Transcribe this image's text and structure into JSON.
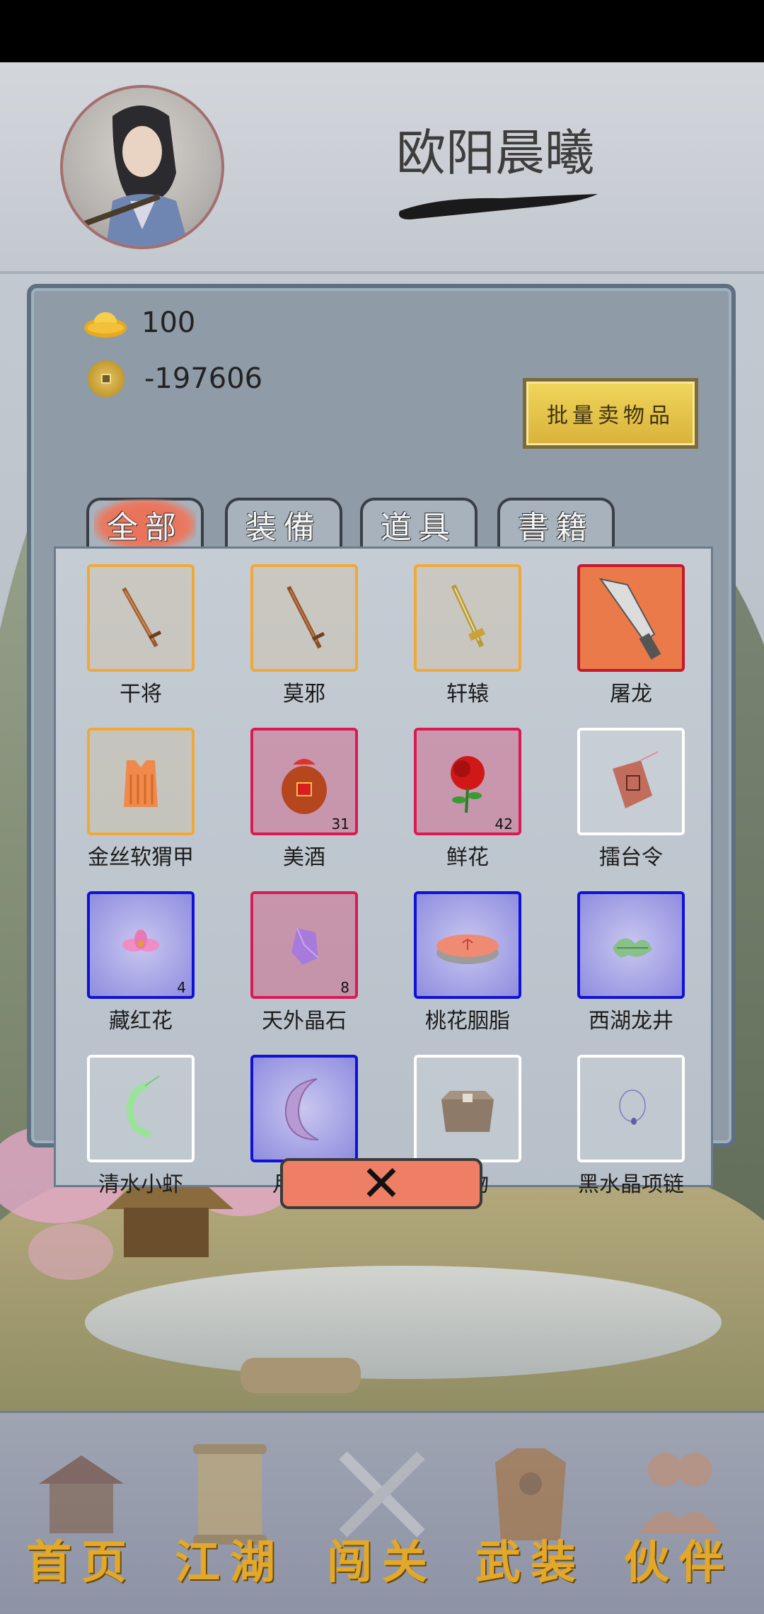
{
  "player": {
    "name": "欧阳晨曦"
  },
  "currency": {
    "gold_ingots": "100",
    "coins": "-197606"
  },
  "actions": {
    "bulk_sell_label": "批量卖物品",
    "close_label": "✕"
  },
  "tabs": [
    {
      "label": "全部",
      "active": true
    },
    {
      "label": "装備",
      "active": false
    },
    {
      "label": "道具",
      "active": false
    },
    {
      "label": "書籍",
      "active": false
    }
  ],
  "items": [
    {
      "name": "干将",
      "rarity": "orange",
      "icon": "sword-icon"
    },
    {
      "name": "莫邪",
      "rarity": "orange",
      "icon": "sword-icon"
    },
    {
      "name": "轩辕",
      "rarity": "orange",
      "icon": "golden-sword-icon"
    },
    {
      "name": "屠龙",
      "rarity": "orange-fill",
      "icon": "broadsword-icon"
    },
    {
      "name": "金丝软猬甲",
      "rarity": "orange",
      "icon": "armor-vest-icon"
    },
    {
      "name": "美酒",
      "rarity": "red",
      "icon": "wine-jar-icon",
      "count": "31"
    },
    {
      "name": "鲜花",
      "rarity": "red",
      "icon": "rose-icon",
      "count": "42"
    },
    {
      "name": "擂台令",
      "rarity": "white",
      "icon": "token-icon"
    },
    {
      "name": "藏红花",
      "rarity": "blue",
      "icon": "saffron-flower-icon",
      "count": "4"
    },
    {
      "name": "天外晶石",
      "rarity": "red",
      "icon": "crystal-icon",
      "count": "8"
    },
    {
      "name": "桃花胭脂",
      "rarity": "blue",
      "icon": "rouge-box-icon"
    },
    {
      "name": "西湖龙井",
      "rarity": "blue",
      "icon": "tea-leaves-icon"
    },
    {
      "name": "清水小虾",
      "rarity": "white",
      "icon": "shrimp-icon"
    },
    {
      "name": "月魔石",
      "rarity": "blue",
      "icon": "moon-stone-icon"
    },
    {
      "name": "镖物",
      "rarity": "white",
      "icon": "cargo-box-icon"
    },
    {
      "name": "黑水晶项链",
      "rarity": "white",
      "icon": "necklace-icon"
    }
  ],
  "nav": [
    {
      "label": "首页",
      "icon": "house-icon"
    },
    {
      "label": "江湖",
      "icon": "scroll-icon"
    },
    {
      "label": "闯关",
      "icon": "crossed-swords-icon"
    },
    {
      "label": "武装",
      "icon": "armor-icon"
    },
    {
      "label": "伙伴",
      "icon": "companions-icon"
    }
  ],
  "colors": {
    "rarity_orange": "#f0a938",
    "rarity_red": "#d81b52",
    "rarity_blue": "#1010d8",
    "rarity_white": "#ffffff",
    "nav_label": "#e3a827"
  }
}
